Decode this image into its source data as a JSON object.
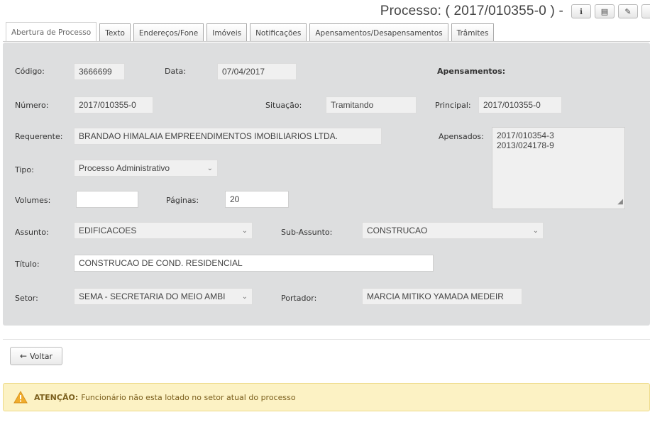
{
  "header": {
    "title": "Processo: ( 2017/010355-0 ) -",
    "buttons": [
      {
        "icon": "info-icon",
        "glyph": "ℹ"
      },
      {
        "icon": "document-icon",
        "glyph": "▤"
      },
      {
        "icon": "edit-icon",
        "glyph": "✎"
      }
    ]
  },
  "tabs": [
    "Abertura de Processo",
    "Texto",
    "Endereços/Fone",
    "Imóveis",
    "Notificações",
    "Apensamentos/Desapensamentos",
    "Trâmites"
  ],
  "form": {
    "codigo_label": "Código:",
    "codigo": "3666699",
    "data_label": "Data:",
    "data": "07/04/2017",
    "numero_label": "Número:",
    "numero": "2017/010355-0",
    "situacao_label": "Situação:",
    "situacao": "Tramitando",
    "requerente_label": "Requerente:",
    "requerente": "BRANDAO HIMALAIA EMPREENDIMENTOS IMOBILIARIOS LTDA.",
    "tipo_label": "Tipo:",
    "tipo": "Processo Administrativo",
    "volumes_label": "Volumes:",
    "volumes": "",
    "paginas_label": "Páginas:",
    "paginas": "20",
    "assunto_label": "Assunto:",
    "assunto": "EDIFICACOES",
    "subassunto_label": "Sub-Assunto:",
    "subassunto": "CONSTRUCAO",
    "titulo_label": "Título:",
    "titulo": "CONSTRUCAO DE COND. RESIDENCIAL",
    "setor_label": "Setor:",
    "setor": "SEMA - SECRETARIA DO MEIO AMBI",
    "portador_label": "Portador:",
    "portador": "MARCIA MITIKO YAMADA MEDEIR"
  },
  "apensamentos": {
    "heading": "Apensamentos:",
    "principal_label": "Principal:",
    "principal": "2017/010355-0",
    "apensados_label": "Apensados:",
    "apensados": [
      "2017/010354-3",
      "2013/024178-9"
    ]
  },
  "footer": {
    "voltar_label": "Voltar"
  },
  "alert": {
    "title": "ATENÇÃO:",
    "message": "Funcionário não esta lotado no setor atual do processo",
    "bg_color": "#fcf2c4"
  },
  "glyphs": {
    "chevron": "⌄",
    "back_arrow": "←",
    "grip": "◢"
  }
}
